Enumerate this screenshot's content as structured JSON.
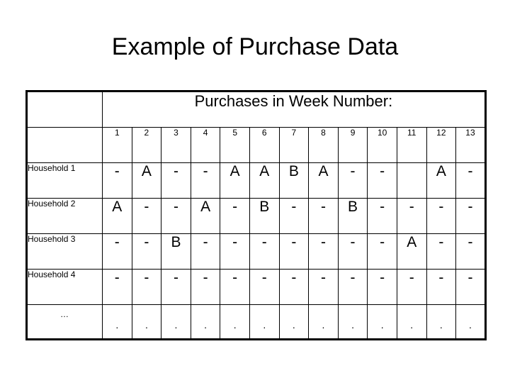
{
  "slide": {
    "title": "Example of Purchase Data"
  },
  "table": {
    "corner_label": "",
    "span_header": "Purchases in Week Number:",
    "week_numbers": [
      "1",
      "2",
      "3",
      "4",
      "5",
      "6",
      "7",
      "8",
      "9",
      "10",
      "11",
      "12",
      "13"
    ],
    "rows": [
      {
        "label": "Household 1",
        "values": [
          "-",
          "A",
          "-",
          "-",
          "A",
          "A",
          "B",
          "A",
          "-",
          "-",
          "",
          "A",
          "-"
        ]
      },
      {
        "label": "Household 2",
        "values": [
          "A",
          "-",
          "-",
          "A",
          "-",
          "B",
          "-",
          "-",
          "B",
          "-",
          "-",
          "-",
          "-"
        ]
      },
      {
        "label": "Household 3",
        "values": [
          "-",
          "-",
          "B",
          "-",
          "-",
          "-",
          "-",
          "-",
          "-",
          "-",
          "A",
          "-",
          "-"
        ]
      },
      {
        "label": "Household 4",
        "values": [
          "-",
          "-",
          "-",
          "-",
          "-",
          "-",
          "-",
          "-",
          "-",
          "-",
          "-",
          "-",
          "-"
        ]
      },
      {
        "label": "…",
        "values": [
          ".",
          ".",
          ".",
          ".",
          ".",
          ".",
          ".",
          ".",
          ".",
          ".",
          ".",
          ".",
          "."
        ]
      }
    ]
  },
  "colors": {
    "background": "#ffffff",
    "text": "#000000",
    "border": "#000000"
  }
}
